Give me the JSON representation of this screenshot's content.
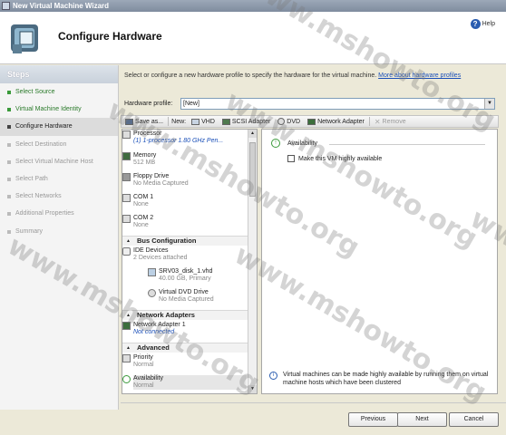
{
  "window": {
    "title": "New Virtual Machine Wizard"
  },
  "header": {
    "page_title": "Configure Hardware",
    "help_label": "Help"
  },
  "steps": {
    "title": "Steps",
    "items": [
      {
        "label": "Select Source",
        "state": "done"
      },
      {
        "label": "Virtual Machine Identity",
        "state": "done"
      },
      {
        "label": "Configure Hardware",
        "state": "active"
      },
      {
        "label": "Select Destination",
        "state": "pending"
      },
      {
        "label": "Select Virtual Machine Host",
        "state": "pending"
      },
      {
        "label": "Select Path",
        "state": "pending"
      },
      {
        "label": "Select Networks",
        "state": "pending"
      },
      {
        "label": "Additional Properties",
        "state": "pending"
      },
      {
        "label": "Summary",
        "state": "pending"
      }
    ]
  },
  "intro": {
    "text": "Select or configure a new hardware profile to specify the hardware for the virtual machine.",
    "link": "More about hardware profiles"
  },
  "hardware_profile": {
    "label": "Hardware profile:",
    "value": "[New]"
  },
  "toolbar": {
    "save_as": "Save as...",
    "new_label": "New:",
    "vhd": "VHD",
    "scsi": "SCSI Adapter",
    "dvd": "DVD",
    "network": "Network Adapter",
    "remove": "Remove"
  },
  "hw_list": {
    "processor": {
      "name": "Processor",
      "value": "(1) 1-processor 1.80 GHz Pen..."
    },
    "memory": {
      "name": "Memory",
      "value": "512 MB"
    },
    "floppy": {
      "name": "Floppy Drive",
      "value": "No Media Captured"
    },
    "com1": {
      "name": "COM 1",
      "value": "None"
    },
    "com2": {
      "name": "COM 2",
      "value": "None"
    },
    "bus_section": "Bus Configuration",
    "ide": {
      "name": "IDE Devices",
      "value": "2 Devices attached"
    },
    "disk": {
      "name": "SRV03_disk_1.vhd",
      "value": "40.00 GB, Primary"
    },
    "dvd": {
      "name": "Virtual DVD Drive",
      "value": "No Media Captured"
    },
    "net_section": "Network Adapters",
    "nic": {
      "name": "Network Adapter 1",
      "value": "Not connected"
    },
    "adv_section": "Advanced",
    "priority": {
      "name": "Priority",
      "value": "Normal"
    },
    "availability": {
      "name": "Availability",
      "value": "Normal"
    }
  },
  "detail": {
    "heading": "Availability",
    "checkbox_label": "Make this VM highly available",
    "checkbox_checked": false,
    "note": "Virtual machines can be made highly available by running them on virtual machine hosts which have been clustered"
  },
  "buttons": {
    "previous": "Previous",
    "next": "Next",
    "cancel": "Cancel"
  },
  "watermark": "www.mshowto.org"
}
